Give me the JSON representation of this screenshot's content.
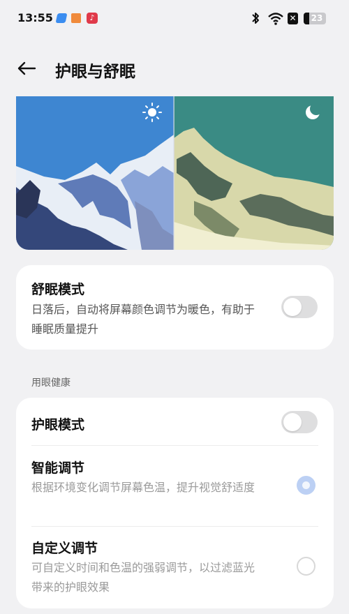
{
  "status_bar": {
    "time": "13:55",
    "music_icon_glyph": "♪",
    "sim_glyph": "✕",
    "battery_level": "23",
    "icons": [
      "app-icon-blue",
      "app-icon-orange",
      "music-app-icon",
      "bluetooth-icon",
      "wifi-icon",
      "no-sim-icon",
      "battery-icon"
    ]
  },
  "header": {
    "title": "护眼与舒眠",
    "back_icon": "back-arrow-icon"
  },
  "preview": {
    "day_icon": "sun-icon",
    "night_icon": "moon-icon",
    "day_sky_color": "#3e86d1",
    "night_sky_color": "#3a8b84"
  },
  "sleep_mode": {
    "title": "舒眠模式",
    "description": "日落后，自动将屏幕颜色调节为暖色，有助于睡眠质量提升",
    "enabled": false
  },
  "eye_health": {
    "section_label": "用眼健康",
    "eye_protection": {
      "title": "护眼模式",
      "enabled": false
    },
    "options": [
      {
        "title": "智能调节",
        "description": "根据环境变化调节屏幕色温，提升视觉舒适度",
        "selected": true
      },
      {
        "title": "自定义调节",
        "description": "可自定义时间和色温的强弱调节，以过滤蓝光带来的护眼效果",
        "selected": false
      }
    ]
  },
  "colors": {
    "accent": "#bcd0f4",
    "background": "#f1f1f3",
    "card": "#ffffff",
    "toggle_off": "#dededf"
  }
}
